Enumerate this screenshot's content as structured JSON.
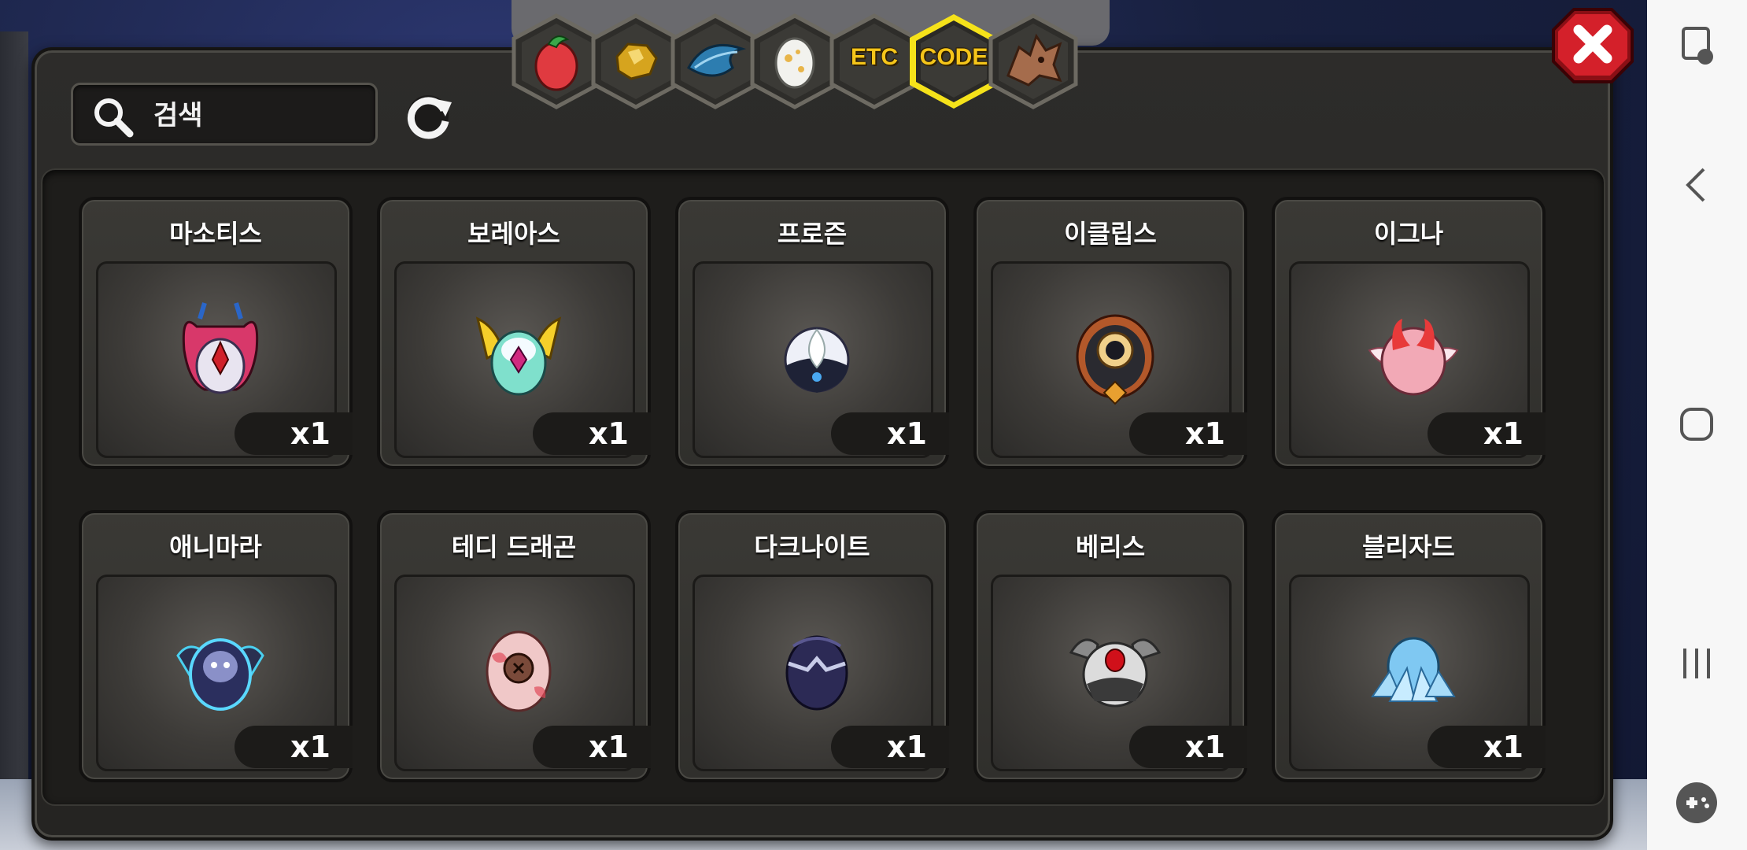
{
  "search": {
    "placeholder": "검색"
  },
  "tabs": [
    {
      "icon": "fruit-icon",
      "label": ""
    },
    {
      "icon": "gold-ore-icon",
      "label": ""
    },
    {
      "icon": "blue-feather-icon",
      "label": ""
    },
    {
      "icon": "egg-icon",
      "label": ""
    },
    {
      "icon": "",
      "label": "ETC"
    },
    {
      "icon": "",
      "label": "CODE",
      "selected": true
    },
    {
      "icon": "dragon-head-icon",
      "label": ""
    }
  ],
  "items": [
    {
      "name": "마소티스",
      "qty": "x1",
      "color": "#d8386a"
    },
    {
      "name": "보레아스",
      "qty": "x1",
      "color": "#5fd6c8"
    },
    {
      "name": "프로즌",
      "qty": "x1",
      "color": "#e8eaf2"
    },
    {
      "name": "이클립스",
      "qty": "x1",
      "color": "#b3582a"
    },
    {
      "name": "이그나",
      "qty": "x1",
      "color": "#f2a9b6"
    },
    {
      "name": "애니마라",
      "qty": "x1",
      "color": "#2b2f5e"
    },
    {
      "name": "테디 드래곤",
      "qty": "x1",
      "color": "#f0c8c8"
    },
    {
      "name": "다크나이트",
      "qty": "x1",
      "color": "#2c2a55"
    },
    {
      "name": "베리스",
      "qty": "x1",
      "color": "#dcdcdc"
    },
    {
      "name": "블리자드",
      "qty": "x1",
      "color": "#7fc8f2"
    }
  ],
  "colors": {
    "accent": "#f5c51a",
    "close": "#d4202a"
  }
}
